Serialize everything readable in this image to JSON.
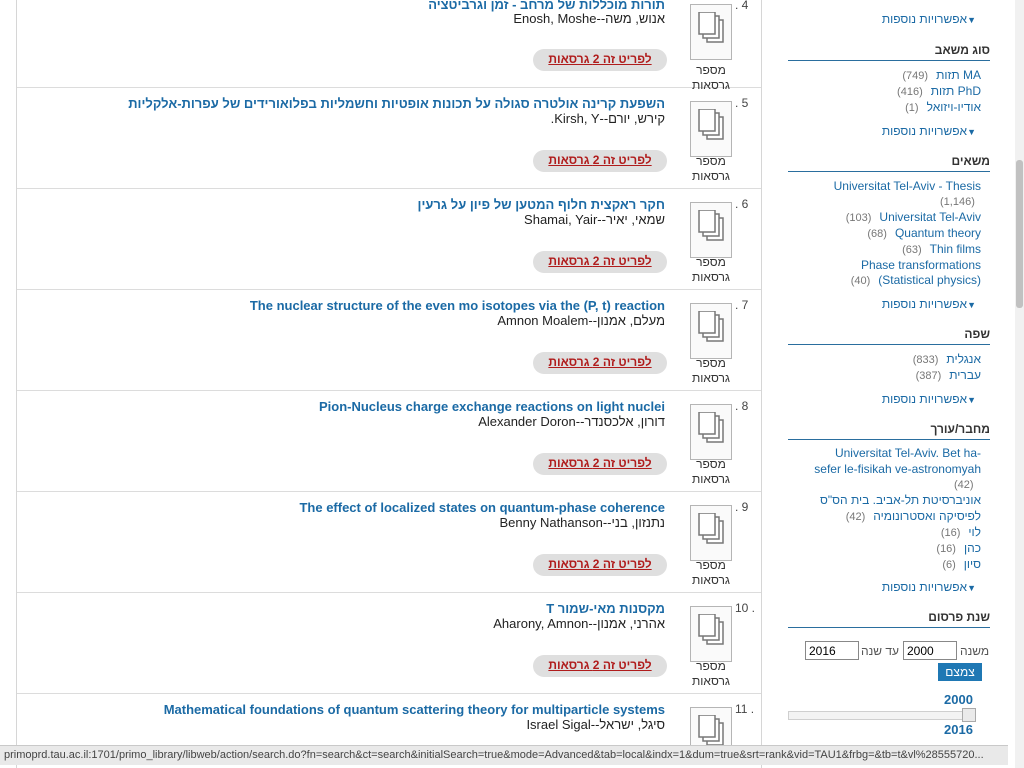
{
  "records": [
    {
      "num": ". 4",
      "title": "תורות מוכללות של מרחב - זמן וגרביטציה",
      "author": "אנוש, משה--Enosh, Moshe",
      "thumb_label": "מספר גרסאות",
      "versions_label": "לפריט זה 2 גרסאות"
    },
    {
      "num": ". 5",
      "title": "השפעת קרינה אולטרה סגולה על תכונות אופטיות וחשמליות בפלואורידים של עפרות-אלקליות",
      "author": "קירש, יורם--Kirsh, Y.",
      "thumb_label": "מספר גרסאות",
      "versions_label": "לפריט זה 2 גרסאות"
    },
    {
      "num": ". 6",
      "title": "חקר ראקצית חלוף המטען של פיון על גרעין",
      "author": "שמאי, יאיר--Shamai, Yair",
      "thumb_label": "מספר גרסאות",
      "versions_label": "לפריט זה 2 גרסאות"
    },
    {
      "num": ". 7",
      "title": "The nuclear structure of the even mo isotopes via the (P, t) reaction",
      "author": "מעלם, אמנון--Amnon Moalem",
      "thumb_label": "מספר גרסאות",
      "versions_label": "לפריט זה 2 גרסאות"
    },
    {
      "num": ". 8",
      "title": "Pion-Nucleus charge exchange reactions on light nuclei",
      "author": "דורון, אלכסנדר--Alexander Doron",
      "thumb_label": "מספר גרסאות",
      "versions_label": "לפריט זה 2 גרסאות"
    },
    {
      "num": ". 9",
      "title": "The effect of localized states on quantum-phase coherence",
      "author": "נתנזון, בני--Benny Nathanson",
      "thumb_label": "מספר גרסאות",
      "versions_label": "לפריט זה 2 גרסאות"
    },
    {
      "num": "10 .",
      "title": "T מקסנות מאי-שמור",
      "author": "אהרני, אמנון--Aharony, Amnon",
      "thumb_label": "מספר גרסאות",
      "versions_label": "לפריט זה 2 גרסאות"
    },
    {
      "num": "11 .",
      "title": "Mathematical foundations of quantum scattering theory for multiparticle systems",
      "author": "סיגל, ישראל--Israel Sigal",
      "thumb_label": "",
      "versions_label": ""
    }
  ],
  "sidebar": {
    "top_more": "אפשרויות נוספות",
    "resource_type": {
      "heading": "סוג משאב",
      "items": [
        {
          "name": "תזות MA",
          "count": "(749)"
        },
        {
          "name": "תזות PhD",
          "count": "(416)"
        },
        {
          "name": "אודיו-ויזואל",
          "count": "(1)"
        }
      ],
      "more": "אפשרויות נוספות"
    },
    "subjects": {
      "heading": "משאים",
      "items": [
        {
          "name": "Universitat Tel-Aviv - Thesis",
          "count": "(1,146)"
        },
        {
          "name": "Universitat Tel-Aviv",
          "count": "(103)"
        },
        {
          "name": "Quantum theory",
          "count": "(68)"
        },
        {
          "name": "Thin films",
          "count": "(63)"
        },
        {
          "name": "Phase transformations",
          "count": ""
        },
        {
          "name": "(Statistical physics)",
          "count": "(40)"
        }
      ],
      "more": "אפשרויות נוספות"
    },
    "language": {
      "heading": "שפה",
      "items": [
        {
          "name": "אנגלית",
          "count": "(833)"
        },
        {
          "name": "עברית",
          "count": "(387)"
        }
      ],
      "more": "אפשרויות נוספות"
    },
    "author": {
      "heading": "מחבר/עורך",
      "items": [
        {
          "name": "Universitat Tel-Aviv. Bet ha-",
          "count": ""
        },
        {
          "name": "sefer le-fisikah ve-astronomyah",
          "count": "(42)"
        },
        {
          "name": "אוניברסיטת תל-אביב. בית הס\"ס",
          "count": ""
        },
        {
          "name": "לפיסיקה ואסטרונומיה",
          "count": "(42)"
        },
        {
          "name": "לוי",
          "count": "(16)"
        },
        {
          "name": "כהן",
          "count": "(16)"
        },
        {
          "name": "סיון",
          "count": "(6)"
        }
      ],
      "more": "אפשרויות נוספות"
    },
    "year": {
      "heading": "שנת פרסום",
      "from_label": "משנה",
      "to_label": "עד שנה",
      "from_value": "2000",
      "to_value": "2016",
      "button": "צמצם",
      "slider_min": "2000",
      "slider_max": "2016"
    }
  },
  "statusbar": {
    "url": "primoprd.tau.ac.il:1701/primo_library/libweb/action/search.do?fn=search&ct=search&initialSearch=true&mode=Advanced&tab=local&indx=1&dum=true&srt=rank&vid=TAU1&frbg=&tb=t&vl%28555720..."
  },
  "colors": {
    "link": "#1b6aa5",
    "versions_text": "#b01c1c",
    "accent": "#1f78b4"
  }
}
